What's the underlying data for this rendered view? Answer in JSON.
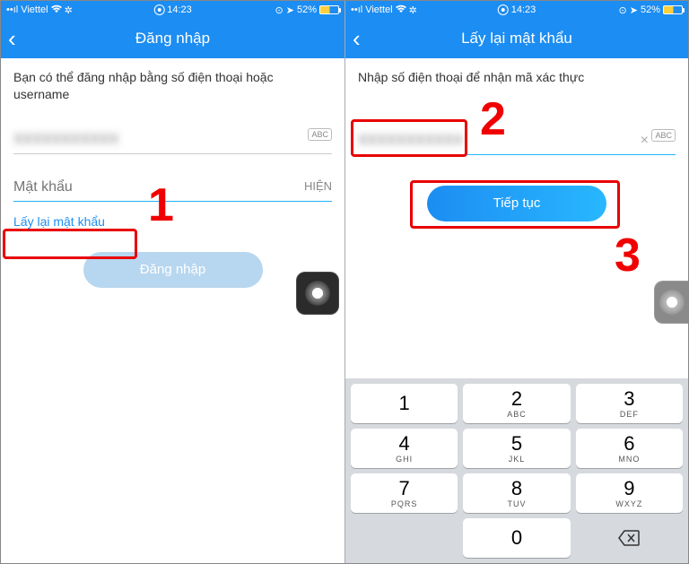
{
  "statusbar": {
    "carrier": "Viettel",
    "time": "14:23",
    "battery": "52%"
  },
  "screen1": {
    "title": "Đăng nhập",
    "instruction": "Bạn có thể đăng nhập bằng số điện thoại hoặc username",
    "phone_masked": "XXXXXXXXXXX",
    "password_placeholder": "Mật khẩu",
    "show_label": "HIỆN",
    "abc": "ABC",
    "forgot_link": "Lấy lại mật khẩu",
    "login_btn": "Đăng nhập",
    "annotation": "1"
  },
  "screen2": {
    "title": "Lấy lại mật khẩu",
    "instruction": "Nhập số điện thoại để nhận mã xác thực",
    "phone_masked": "XXXXXXXXXXX",
    "abc": "ABC",
    "continue_btn": "Tiếp tục",
    "annotation_input": "2",
    "annotation_btn": "3",
    "keypad": [
      {
        "d": "1",
        "l": ""
      },
      {
        "d": "2",
        "l": "ABC"
      },
      {
        "d": "3",
        "l": "DEF"
      },
      {
        "d": "4",
        "l": "GHI"
      },
      {
        "d": "5",
        "l": "JKL"
      },
      {
        "d": "6",
        "l": "MNO"
      },
      {
        "d": "7",
        "l": "PQRS"
      },
      {
        "d": "8",
        "l": "TUV"
      },
      {
        "d": "9",
        "l": "WXYZ"
      },
      {
        "d": "",
        "l": ""
      },
      {
        "d": "0",
        "l": ""
      },
      {
        "d": "del",
        "l": ""
      }
    ]
  }
}
